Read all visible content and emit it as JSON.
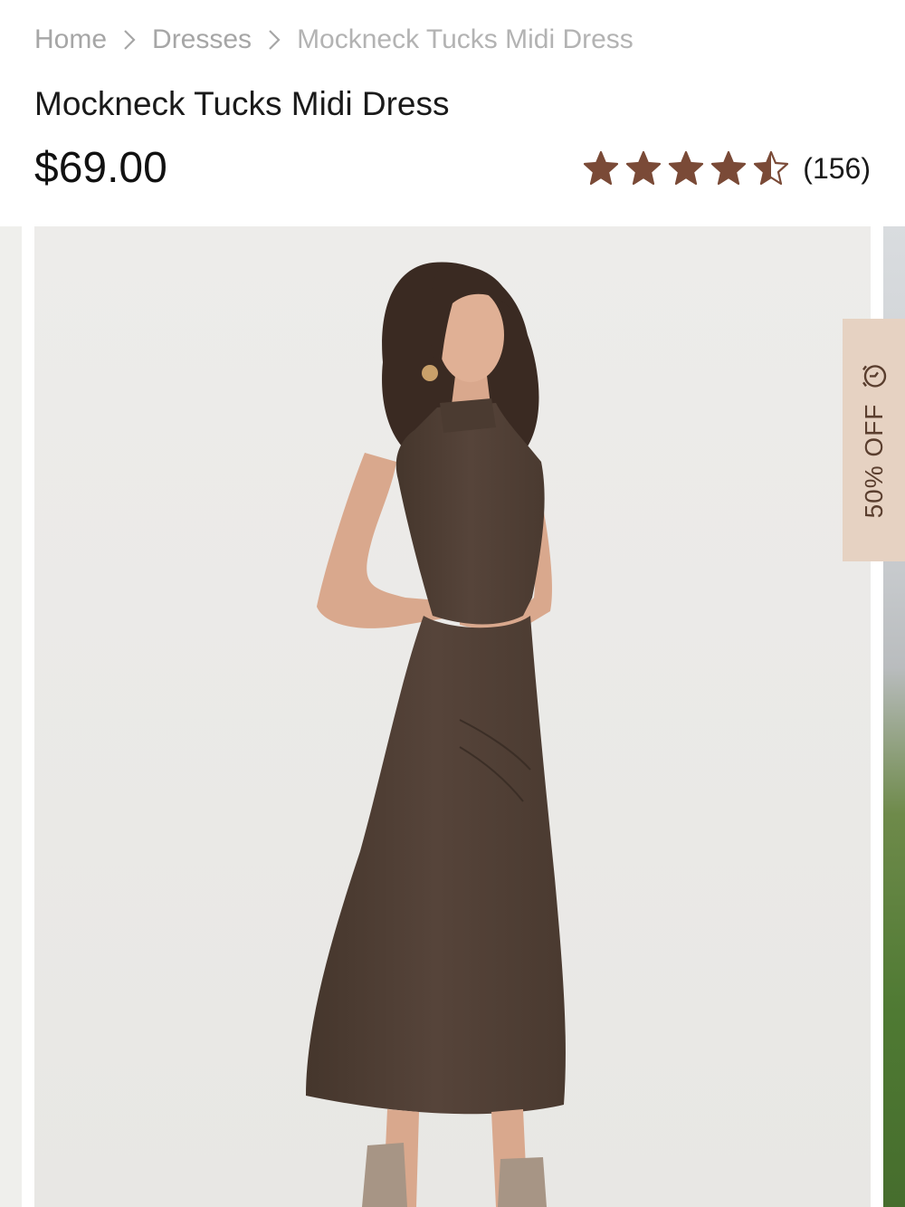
{
  "breadcrumb": {
    "home": "Home",
    "category": "Dresses",
    "current": "Mockneck Tucks Midi Dress"
  },
  "product": {
    "title": "Mockneck Tucks Midi Dress",
    "price": "$69.00",
    "rating": 4.5,
    "rating_max": 5,
    "review_count": "(156)"
  },
  "promo": {
    "discount_label": "50% OFF"
  },
  "icons": {
    "breadcrumb_separator": "chevron-right-icon",
    "rating": "star-icon",
    "promo": "alarm-clock-icon"
  },
  "colors": {
    "star": "#7a4a37",
    "discount_tab": "#e6d2c2",
    "discount_text": "#5a3e2e",
    "dress": "#4e3e33"
  }
}
